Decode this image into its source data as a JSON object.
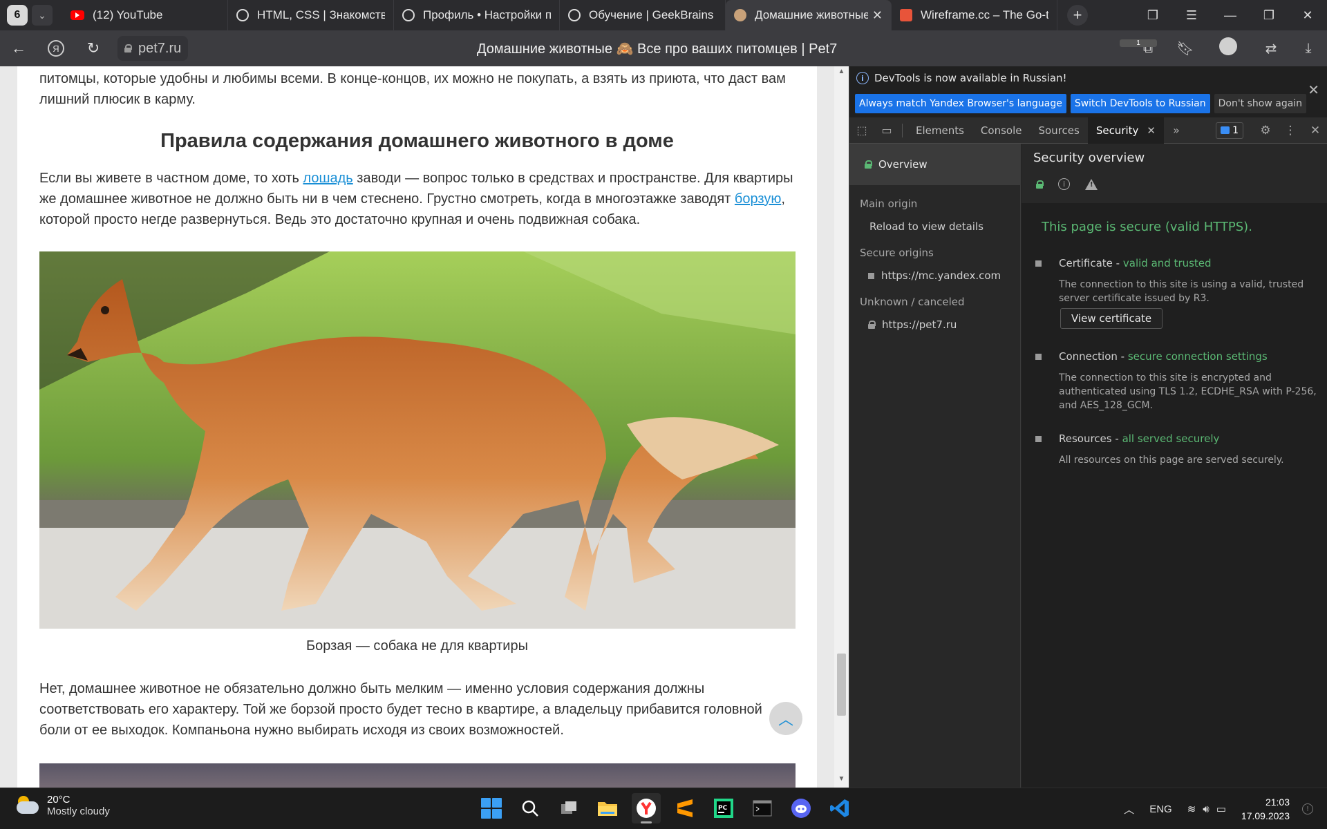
{
  "tabstrip": {
    "tab_count": "6",
    "tabs": [
      {
        "title": "(12) YouTube",
        "favicon": "youtube-icon",
        "active": false
      },
      {
        "title": "HTML, CSS | Знакомство",
        "favicon": "openai-icon",
        "active": false
      },
      {
        "title": "Профиль • Настройки п",
        "favicon": "openai-icon",
        "active": false
      },
      {
        "title": "Обучение | GeekBrains -",
        "favicon": "openai-icon",
        "active": false
      },
      {
        "title": "Домашние животные",
        "favicon": "pet7-icon",
        "active": true
      },
      {
        "title": "Wireframe.cc – The Go-to",
        "favicon": "wireframe-icon",
        "active": false
      }
    ]
  },
  "addressbar": {
    "url": "pet7.ru",
    "page_title": "Домашние животные 🙈 Все про ваших питомцев | Pet7",
    "extension_badge": "1"
  },
  "article": {
    "intro_text": "питомцы, которые удобны и любимы всеми. В конце-концов, их можно не покупать, а взять из приюта, что даст вам лишний плюсик в карму.",
    "heading": "Правила содержания домашнего животного в доме",
    "para1_a": "Если вы живете в частном доме, то хоть ",
    "para1_link1": "лошадь",
    "para1_b": " заводи — вопрос только в средствах и пространстве. Для квартиры же домашнее животное не должно быть ни в чем стеснено. Грустно смотреть, когда в многоэтажке заводят ",
    "para1_link2": "борзую",
    "para1_c": ", которой просто негде развернуться. Ведь это достаточно крупная и очень подвижная собака.",
    "caption": "Борзая — собака не для квартиры",
    "para2": "Нет, домашнее животное не обязательно должно быть мелким — именно условия содержания должны соответствовать его характеру. Той же борзой просто будет тесно в квартире, а владельцу прибавится головной боли от ее выходок. Компаньона нужно выбирать исходя из своих возможностей."
  },
  "devtools": {
    "info_message": "DevTools is now available in Russian!",
    "btn_match": "Always match Yandex Browser's language",
    "btn_switch": "Switch DevTools to Russian",
    "btn_dont_show": "Don't show again",
    "tabs": [
      "Elements",
      "Console",
      "Sources",
      "Security"
    ],
    "active_tab": "Security",
    "issues_count": "1",
    "sidebar": {
      "overview": "Overview",
      "main_origin_header": "Main origin",
      "main_origin_item": "Reload to view details",
      "secure_origins_header": "Secure origins",
      "secure_origin_item": "https://mc.yandex.com",
      "unknown_header": "Unknown / canceled",
      "unknown_item": "https://pet7.ru"
    },
    "main": {
      "title": "Security overview",
      "secure_text": "This page is secure (valid HTTPS).",
      "cert_label": "Certificate - ",
      "cert_status": "valid and trusted",
      "cert_desc": "The connection to this site is using a valid, trusted server certificate issued by R3.",
      "view_cert": "View certificate",
      "conn_label": "Connection - ",
      "conn_status": "secure connection settings",
      "conn_desc": "The connection to this site is encrypted and authenticated using TLS 1.2, ECDHE_RSA with P-256, and AES_128_GCM.",
      "res_label": "Resources - ",
      "res_status": "all served securely",
      "res_desc": "All resources on this page are served securely."
    }
  },
  "taskbar": {
    "temperature": "20°C",
    "weather": "Mostly cloudy",
    "language": "ENG",
    "time": "21:03",
    "date": "17.09.2023"
  },
  "colors": {
    "link": "#1a8fd6",
    "secure_green": "#5bb974",
    "devtools_primary_button": "#1a73e8"
  }
}
